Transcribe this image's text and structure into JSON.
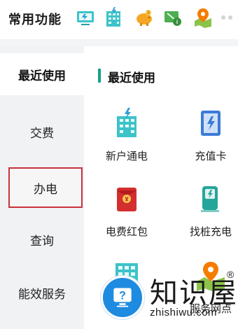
{
  "header": {
    "title": "常用功能",
    "quick_icons": [
      "monitor-icon",
      "building-power-icon",
      "piggy-bank-icon",
      "charging-info-icon",
      "location-map-icon"
    ]
  },
  "sidebar": {
    "items": [
      {
        "label": "最近使用",
        "state": "active"
      },
      {
        "label": "交费",
        "state": "normal"
      },
      {
        "label": "办电",
        "state": "highlighted"
      },
      {
        "label": "查询",
        "state": "normal"
      },
      {
        "label": "能效服务",
        "state": "normal"
      }
    ]
  },
  "main": {
    "section_title": "最近使用",
    "items": [
      {
        "label": "新户通电",
        "icon": "new-household-power-icon"
      },
      {
        "label": "充值卡",
        "icon": "recharge-card-icon"
      },
      {
        "label": "电费红包",
        "icon": "red-envelope-icon"
      },
      {
        "label": "找桩充电",
        "icon": "charging-station-icon"
      },
      {
        "label": "",
        "icon": "building-icon"
      },
      {
        "label": "服务网点",
        "icon": "service-point-map-icon"
      }
    ]
  },
  "watermark": {
    "text": "知识屋",
    "url": "zhishiwu.com",
    "reg": "®"
  },
  "colors": {
    "accent": "#16a085",
    "highlight_border": "#c9313a",
    "sidebar_bg": "#f1f2f4"
  }
}
